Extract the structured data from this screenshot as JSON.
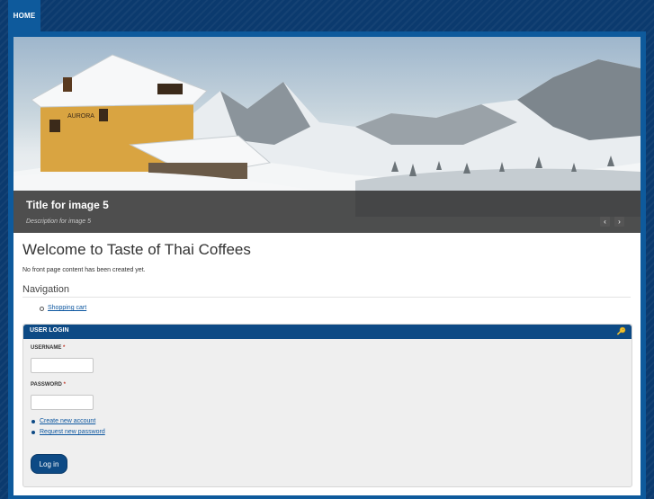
{
  "nav": {
    "home_label": "HOME"
  },
  "slideshow": {
    "caption_title": "Title for image 5",
    "caption_description": "Description for image 5",
    "prev_glyph": "‹",
    "next_glyph": "›"
  },
  "main": {
    "page_title": "Welcome to Taste of Thai Coffees",
    "front_message": "No front page content has been created yet.",
    "navigation_title": "Navigation",
    "navigation_links": [
      "Shopping cart"
    ]
  },
  "login": {
    "title": "USER LOGIN",
    "username_label": "USERNAME",
    "password_label": "PASSWORD",
    "required_mark": "*",
    "links": [
      "Create new account",
      "Request new password"
    ],
    "submit_label": "Log in",
    "icon": "key-icon"
  },
  "colors": {
    "brand_dark": "#0b3a6e",
    "brand_accent": "#0e5a9c",
    "header_blue": "#0d4a85",
    "link_blue": "#0d57a0"
  }
}
